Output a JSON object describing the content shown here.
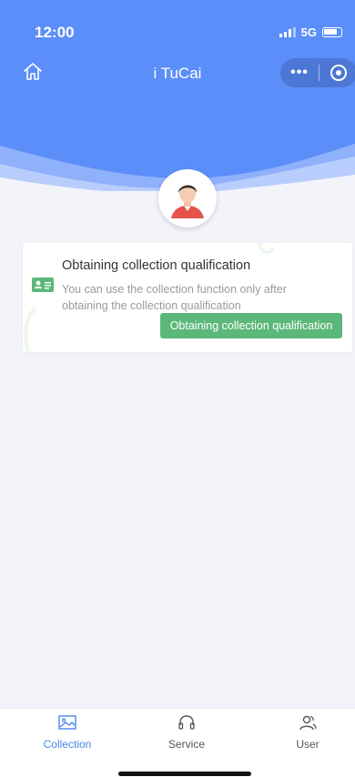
{
  "status_bar": {
    "time": "12:00",
    "network": "5G"
  },
  "nav": {
    "title": "i TuCai",
    "more_glyph": "•••"
  },
  "card": {
    "title": "Obtaining collection qualification",
    "description": "You can use the collection function only after obtaining the collection qualification",
    "button_label": "Obtaining collection qualification"
  },
  "tabbar": {
    "items": [
      {
        "label": "Collection",
        "icon": "image-icon",
        "active": true
      },
      {
        "label": "Service",
        "icon": "headset-icon",
        "active": false
      },
      {
        "label": "User",
        "icon": "users-icon",
        "active": false
      }
    ]
  },
  "colors": {
    "header_blue": "#5b8ef8",
    "accent_green": "#5cb87a",
    "active_tab": "#4a86e8"
  }
}
